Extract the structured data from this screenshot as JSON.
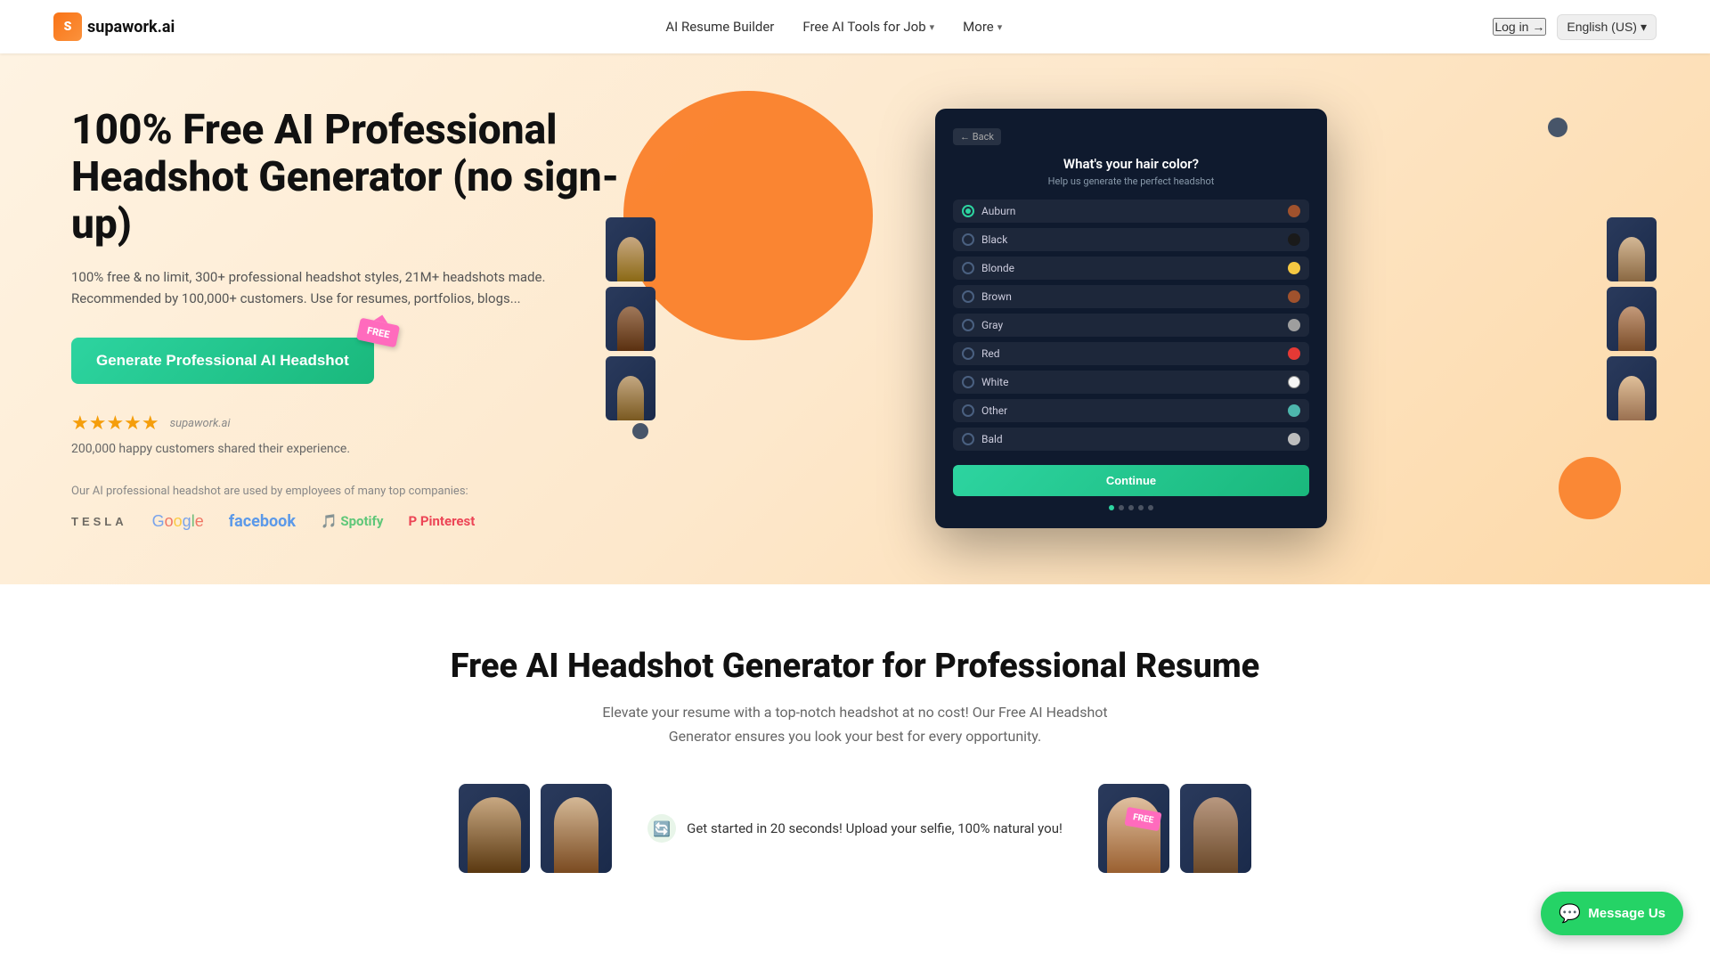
{
  "navbar": {
    "logo_text": "supawork.ai",
    "logo_letter": "S",
    "links": [
      {
        "id": "ai-resume",
        "label": "AI Resume Builder",
        "has_dropdown": false
      },
      {
        "id": "free-tools",
        "label": "Free AI Tools for Job",
        "has_dropdown": true
      },
      {
        "id": "more",
        "label": "More",
        "has_dropdown": true
      }
    ],
    "login_label": "Log in →",
    "language_label": "English (US)",
    "language_chevron": "▾"
  },
  "hero": {
    "title": "100% Free AI Professional Headshot Generator (no sign-up)",
    "subtitle": "100% free & no limit, 300+ professional headshot styles, 21M+ headshots made. Recommended by 100,000+ customers. Use for resumes, portfolios, blogs...",
    "cta_label": "Generate Professional AI Headshot",
    "free_badge": "FREE",
    "stars": "★★★★★",
    "brand_label": "supawork.ai",
    "customers_text": "200,000 happy customers shared their experience.",
    "companies_intro": "Our AI professional headshot are used by employees of many top companies:",
    "companies": [
      {
        "id": "tesla",
        "label": "TESLA"
      },
      {
        "id": "google",
        "label": "Google"
      },
      {
        "id": "facebook",
        "label": "facebook"
      },
      {
        "id": "spotify",
        "label": "Spotify"
      },
      {
        "id": "pinterest",
        "label": "Pinterest"
      }
    ]
  },
  "mockup": {
    "back_label": "← Back",
    "question": "What's your hair color?",
    "help_text": "Help us generate the perfect headshot",
    "hair_options": [
      {
        "id": "auburn",
        "label": "Auburn",
        "color": "#a0522d",
        "selected": true
      },
      {
        "id": "black",
        "label": "Black",
        "color": "#1a1a1a",
        "selected": false
      },
      {
        "id": "blonde",
        "label": "Blonde",
        "color": "#f5c842",
        "selected": false
      },
      {
        "id": "brown",
        "label": "Brown",
        "color": "#a0522d",
        "selected": false
      },
      {
        "id": "gray",
        "label": "Gray",
        "color": "#9e9e9e",
        "selected": false
      },
      {
        "id": "red",
        "label": "Red",
        "color": "#e53935",
        "selected": false
      },
      {
        "id": "white",
        "label": "White",
        "color": "#f5f5f5",
        "selected": false
      },
      {
        "id": "other",
        "label": "Other",
        "color": "#4db6ac",
        "selected": false
      },
      {
        "id": "bald",
        "label": "Bald",
        "color": "#bdbdbd",
        "selected": false
      }
    ],
    "continue_label": "Continue",
    "progress_dots": 5,
    "active_dot": 1
  },
  "section2": {
    "title": "Free AI Headshot Generator for Professional Resume",
    "subtitle": "Elevate your resume with a top-notch headshot at no cost! Our Free AI Headshot Generator ensures you look your best for every opportunity.",
    "feature_text": "Get started in 20 seconds! Upload your selfie, 100% natural you!",
    "free_badge": "FREE"
  },
  "message_us": {
    "label": "Message Us",
    "icon": "💬"
  }
}
